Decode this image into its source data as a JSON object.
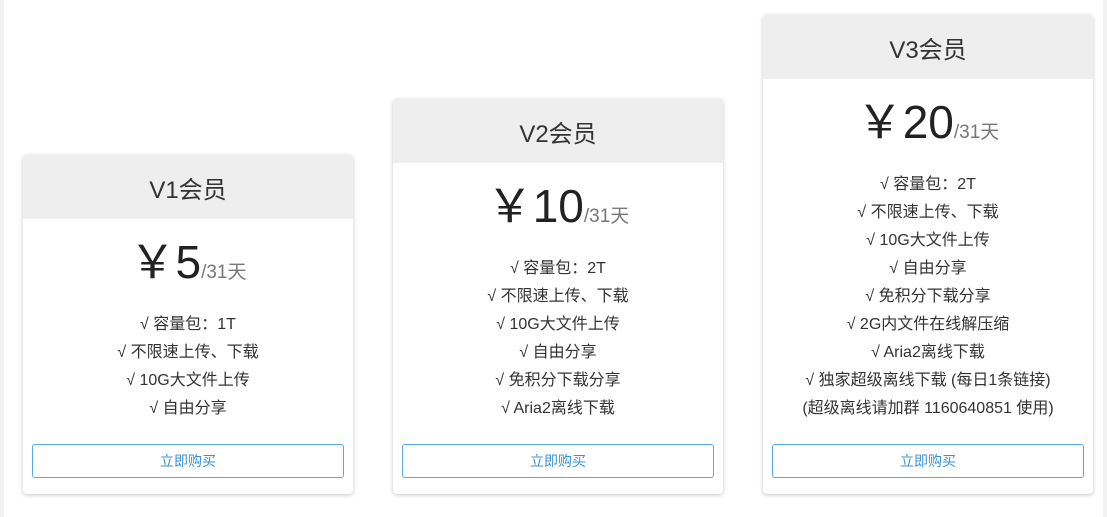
{
  "plans": [
    {
      "title": "V1会员",
      "amount": "￥5",
      "period": "/31天",
      "features": [
        "√ 容量包：1T",
        "√ 不限速上传、下载",
        "√ 10G大文件上传",
        "√ 自由分享"
      ],
      "button": "立即购买"
    },
    {
      "title": "V2会员",
      "amount": "￥10",
      "period": "/31天",
      "features": [
        "√ 容量包：2T",
        "√ 不限速上传、下载",
        "√ 10G大文件上传",
        "√ 自由分享",
        "√ 免积分下载分享",
        "√ Aria2离线下载"
      ],
      "button": "立即购买"
    },
    {
      "title": "V3会员",
      "amount": "￥20",
      "period": "/31天",
      "features": [
        "√ 容量包：2T",
        "√ 不限速上传、下载",
        "√ 10G大文件上传",
        "√ 自由分享",
        "√ 免积分下载分享",
        "√ 2G内文件在线解压缩",
        "√ Aria2离线下载",
        "√ 独家超级离线下载 (每日1条链接)",
        "(超级离线请加群 1160640851 使用)"
      ],
      "button": "立即购买"
    }
  ]
}
